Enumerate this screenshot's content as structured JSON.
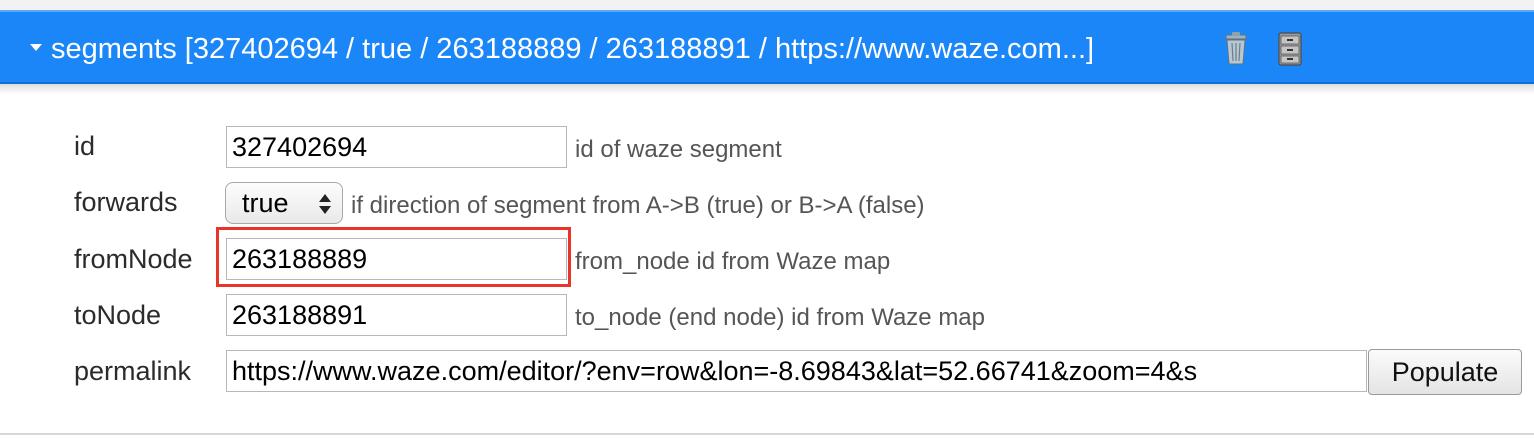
{
  "header": {
    "title": "segments [327402694 / true / 263188889 / 263188891 / https://www.waze.com...]",
    "bg_color": "#1b86f7",
    "icons": [
      "trash-icon",
      "file-cabinet-icon"
    ]
  },
  "fields": {
    "id": {
      "label": "id",
      "value": "327402694",
      "hint": "id of waze segment"
    },
    "forwards": {
      "label": "forwards",
      "value": "true",
      "hint": "if direction of segment from A->B (true) or B->A (false)"
    },
    "fromNode": {
      "label": "fromNode",
      "value": "263188889",
      "hint": "from_node id from Waze map"
    },
    "toNode": {
      "label": "toNode",
      "value": "263188891",
      "hint": "to_node (end node) id from Waze map"
    },
    "permalink": {
      "label": "permalink",
      "value": "https://www.waze.com/editor/?env=row&lon=-8.69843&lat=52.66741&zoom=4&s",
      "button": "Populate"
    }
  },
  "highlight_color": "#e8352a"
}
